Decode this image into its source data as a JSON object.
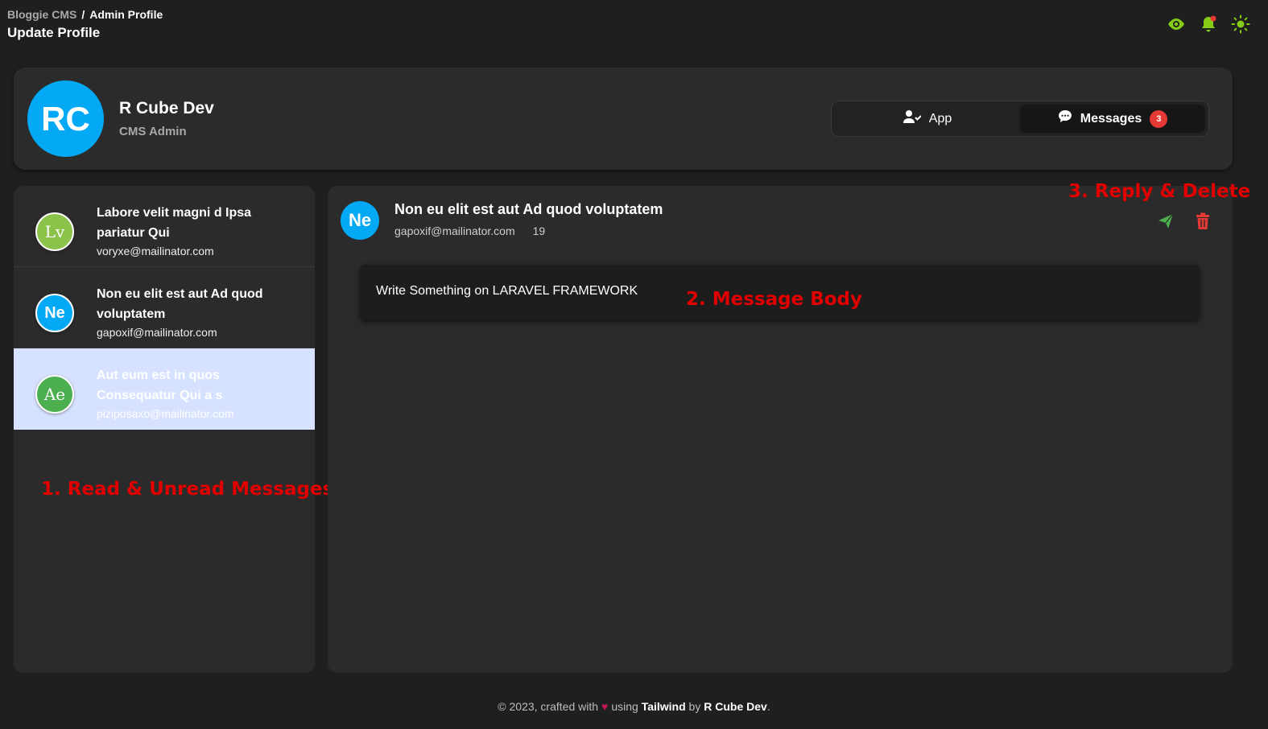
{
  "breadcrumb": {
    "root": "Bloggie CMS",
    "separator": "/",
    "current": "Admin Profile"
  },
  "page_title": "Update Profile",
  "top_icons": [
    "eye-icon",
    "bell-icon",
    "sun-icon"
  ],
  "profile": {
    "initials": "RC",
    "name": "R Cube Dev",
    "role": "CMS Admin",
    "avatar_color": "#03a9f4"
  },
  "tabs": [
    {
      "label": "App",
      "icon": "user-check-icon",
      "active": false
    },
    {
      "label": "Messages",
      "icon": "chat-bubble-icon",
      "active": true,
      "badge": "3"
    }
  ],
  "messages": [
    {
      "initials": "Lv",
      "title": "Labore velit magni d Ipsa pariatur Qui",
      "email": "voryxe@mailinator.com",
      "avatar_color": "#8bc34a",
      "selected": false
    },
    {
      "initials": "Ne",
      "title": "Non eu elit est aut Ad quod voluptatem",
      "email": "gapoxif@mailinator.com",
      "avatar_color": "#03a9f4",
      "selected": false
    },
    {
      "initials": "Ae",
      "title": "Aut eum est in quos Consequatur Qui a s",
      "email": "piziposaxo@mailinator.com",
      "avatar_color": "#4caf50",
      "selected": true
    }
  ],
  "detail": {
    "initials": "Ne",
    "subject": "Non eu elit est aut Ad quod voluptatem",
    "email": "gapoxif@mailinator.com",
    "count": "19",
    "body": "Write Something on LARAVEL FRAMEWORK"
  },
  "annotations": {
    "list": "1. Read & Unread Messages",
    "body": "2. Message Body",
    "actions": "3. Reply & Delete"
  },
  "footer": {
    "prefix": "© 2023, crafted with",
    "using": "using",
    "tech": "Tailwind",
    "by": "by",
    "author": "R Cube Dev",
    "suffix": "."
  },
  "colors": {
    "accent_green": "#84cc16",
    "reply_green": "#4caf50",
    "delete_red": "#e53935",
    "annotation_red": "#e10000"
  }
}
